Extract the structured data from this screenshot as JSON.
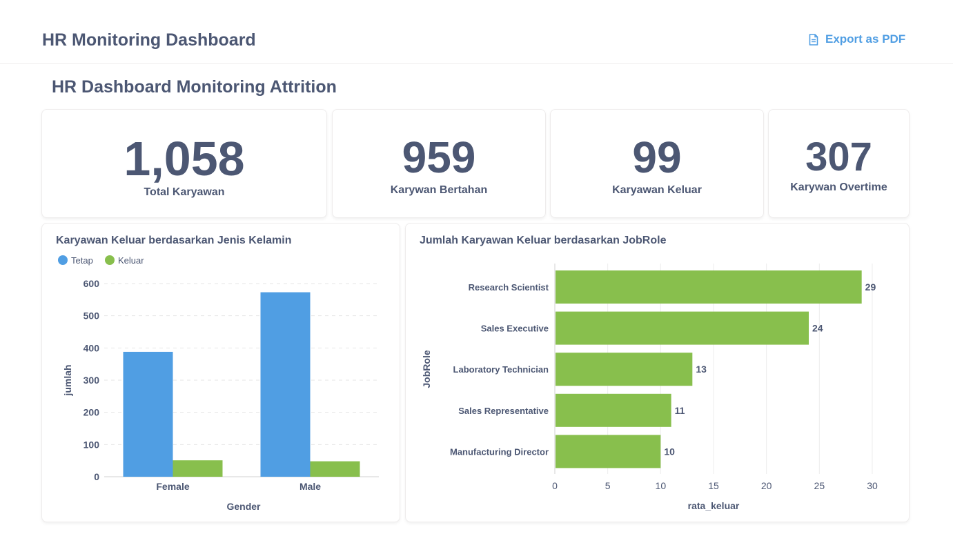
{
  "header": {
    "title": "HR Monitoring Dashboard",
    "export_label": "Export as PDF",
    "export_icon": "document-icon"
  },
  "dashboard": {
    "heading": "HR Dashboard Monitoring Attrition"
  },
  "kpis": [
    {
      "value": "1,058",
      "label": "Total Karyawan"
    },
    {
      "value": "959",
      "label": "Karywan Bertahan"
    },
    {
      "value": "99",
      "label": "Karyawan Keluar"
    },
    {
      "value": "307",
      "label": "Karywan Overtime"
    }
  ],
  "colors": {
    "tetap": "#509ee3",
    "keluar": "#88bf4d",
    "text": "#4c5773",
    "accent": "#509ee3"
  },
  "chart_data": [
    {
      "type": "bar",
      "title": "Karyawan Keluar berdasarkan Jenis Kelamin",
      "categories": [
        "Female",
        "Male"
      ],
      "series": [
        {
          "name": "Tetap",
          "values": [
            388,
            573
          ]
        },
        {
          "name": "Keluar",
          "values": [
            51,
            48
          ]
        }
      ],
      "xlabel": "Gender",
      "ylabel": "jumlah",
      "ylim": [
        0,
        600
      ],
      "yticks": [
        0,
        100,
        200,
        300,
        400,
        500,
        600
      ],
      "legend": "top-left",
      "grid": true
    },
    {
      "type": "bar",
      "orientation": "horizontal",
      "title": "Jumlah Karyawan Keluar berdasarkan JobRole",
      "categories": [
        "Research Scientist",
        "Sales Executive",
        "Laboratory Technician",
        "Sales Representative",
        "Manufacturing Director"
      ],
      "values": [
        29,
        24,
        13,
        11,
        10
      ],
      "xlabel": "rata_keluar",
      "ylabel": "JobRole",
      "xlim": [
        0,
        30
      ],
      "xticks": [
        0,
        5,
        10,
        15,
        20,
        25,
        30
      ],
      "grid": true
    }
  ]
}
